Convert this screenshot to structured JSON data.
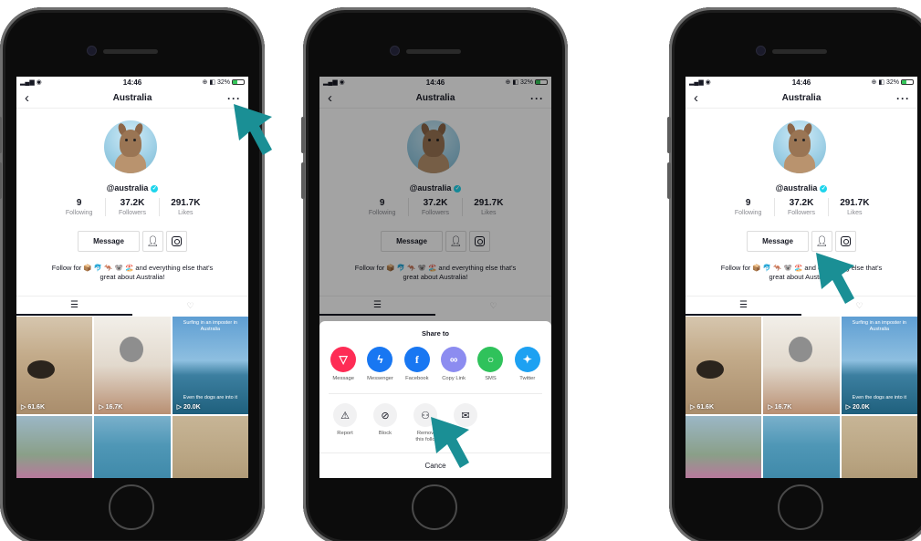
{
  "status": {
    "time": "14:46",
    "battery": "32%"
  },
  "profile": {
    "title": "Australia",
    "handle": "@australia",
    "stats": [
      {
        "value": "9",
        "label": "Following"
      },
      {
        "value": "37.2K",
        "label": "Followers"
      },
      {
        "value": "291.7K",
        "label": "Likes"
      }
    ],
    "message_label": "Message",
    "bio_line1": "Follow for 📦 🐬 🦘 🐨 🏖️ and everything else that's",
    "bio_line2": "great about Australia!",
    "videos": [
      {
        "views": "61.6K",
        "caption": ""
      },
      {
        "views": "16.7K",
        "caption": ""
      },
      {
        "views": "20.0K",
        "caption_top": "Surfing in an imposter in Australia",
        "caption": "Even the dogs are into it"
      },
      {
        "views": "",
        "caption": ""
      },
      {
        "views": "",
        "caption": ""
      },
      {
        "views": "",
        "caption": ""
      }
    ]
  },
  "share_sheet": {
    "title": "Share to",
    "targets": [
      {
        "label": "Message",
        "color": "#fe2c55",
        "icon": "send-icon"
      },
      {
        "label": "Messenger",
        "color": "#1877f2",
        "icon": "messenger-icon"
      },
      {
        "label": "Facebook",
        "color": "#1877f2",
        "icon": "facebook-icon"
      },
      {
        "label": "Copy Link",
        "color": "#8c8cf0",
        "icon": "link-icon"
      },
      {
        "label": "SMS",
        "color": "#2fc25b",
        "icon": "sms-icon"
      },
      {
        "label": "Twitter",
        "color": "#1da1f2",
        "icon": "twitter-icon"
      }
    ],
    "actions": [
      {
        "label": "Report",
        "icon": "warning-icon"
      },
      {
        "label": "Block",
        "icon": "block-icon"
      },
      {
        "label": "Remove this follower",
        "label_1": "Remov",
        "label_2": "this follo",
        "icon": "remove-follower-icon"
      },
      {
        "label": "",
        "icon": "mail-icon"
      }
    ],
    "cancel_label": "Cancel",
    "cancel_visible": "Cance"
  },
  "colors": {
    "arrow": "#1a8f95",
    "accent": "#fe2c55",
    "verified": "#20d5ec"
  },
  "icons": {
    "back": "chevron-left-icon",
    "more": "more-icon",
    "swap": "person-swap-icon",
    "instagram": "instagram-icon",
    "grid": "grid-icon",
    "liked": "heart-icon"
  }
}
